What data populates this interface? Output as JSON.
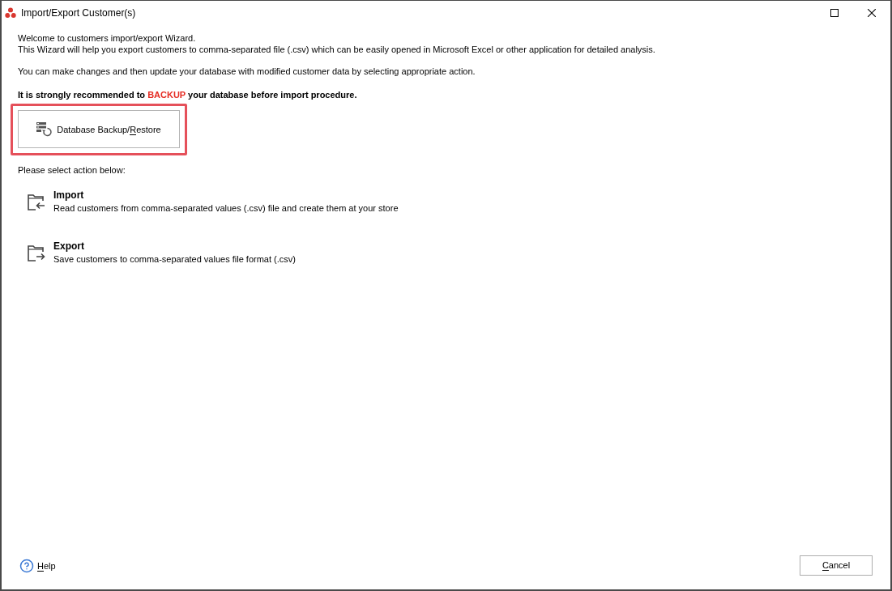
{
  "window": {
    "title": "Import/Export Customer(s)"
  },
  "intro": [
    "Welcome to customers import/export Wizard.",
    "This Wizard will help you export customers to comma-separated file (.csv) which can be easily opened in Microsoft Excel or other application for detailed analysis."
  ],
  "note": "You can make changes and then update your database with modified customer data by selecting appropriate action.",
  "warning": {
    "before": "It is strongly recommended to ",
    "emphasis": "BACKUP",
    "after": " your database before import procedure."
  },
  "backup_button": {
    "label": [
      {
        "text": "Database Backup/",
        "underlined": false
      },
      {
        "text": "R",
        "underlined": true
      },
      {
        "text": "estore",
        "underlined": false
      }
    ],
    "highlighted": true
  },
  "actions_prompt": "Please select action below:",
  "actions": [
    {
      "kind": "import",
      "title": "Import",
      "description": "Read customers from comma-separated values (.csv) file and create them at your store"
    },
    {
      "kind": "export",
      "title": "Export",
      "description": "Save customers to comma-separated values file format (.csv)"
    }
  ],
  "footer": {
    "help": {
      "label": [
        {
          "text": "H",
          "underlined": true
        },
        {
          "text": "elp",
          "underlined": false
        }
      ]
    },
    "cancel": {
      "label": [
        {
          "text": "C",
          "underlined": true
        },
        {
          "text": "ancel",
          "underlined": false
        }
      ]
    }
  }
}
